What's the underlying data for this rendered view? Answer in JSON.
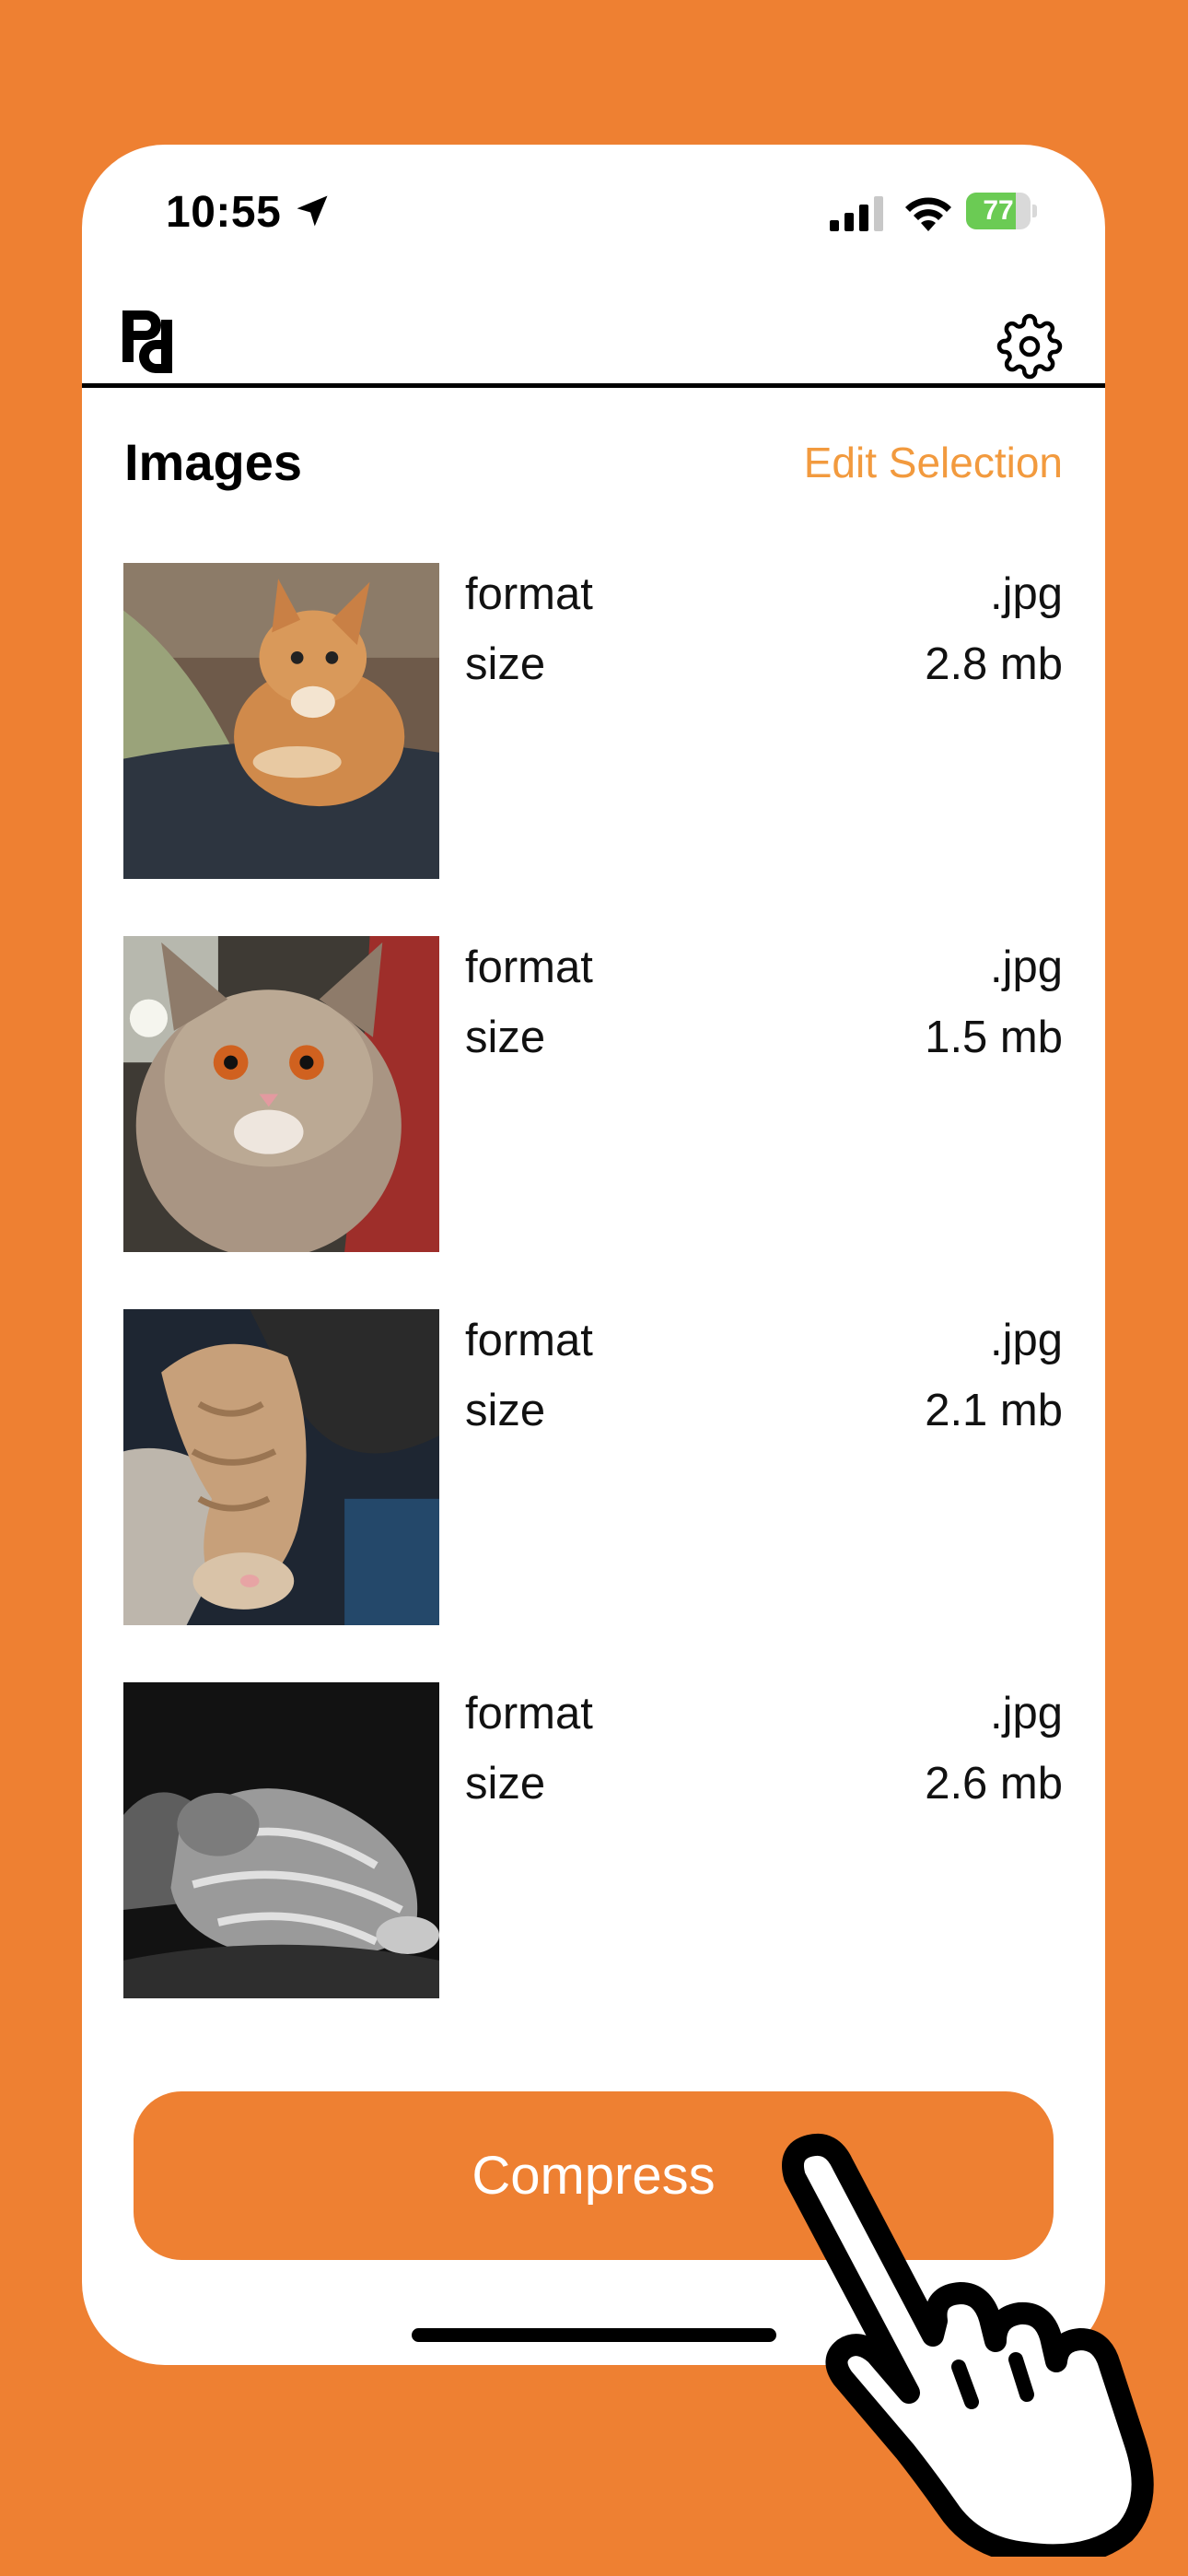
{
  "status_bar": {
    "time": "10:55",
    "battery": "77",
    "battery_level_percent": 77
  },
  "nav": {
    "logo_icon": "pd-logo-icon",
    "settings_icon": "gear-icon"
  },
  "header": {
    "title": "Images",
    "edit_label": "Edit Selection"
  },
  "images": [
    {
      "format_label": "format",
      "format_value": ".jpg",
      "size_label": "size",
      "size_value": "2.8 mb"
    },
    {
      "format_label": "format",
      "format_value": ".jpg",
      "size_label": "size",
      "size_value": "1.5 mb"
    },
    {
      "format_label": "format",
      "format_value": ".jpg",
      "size_label": "size",
      "size_value": "2.1 mb"
    },
    {
      "format_label": "format",
      "format_value": ".jpg",
      "size_label": "size",
      "size_value": "2.6 mb"
    }
  ],
  "actions": {
    "compress_label": "Compress"
  },
  "colors": {
    "background": "#EE8032",
    "accent": "#F29A3E",
    "battery": "#6BCB54"
  }
}
